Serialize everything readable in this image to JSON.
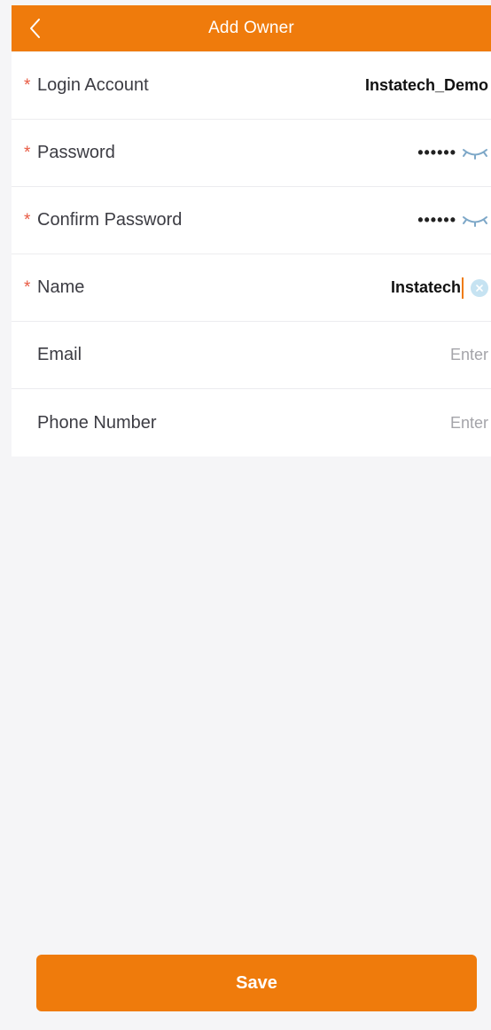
{
  "header": {
    "title": "Add Owner",
    "back_icon": "chevron-left-icon"
  },
  "form": {
    "login_account": {
      "label": "Login Account",
      "required": "*",
      "value": "Instatech_Demo"
    },
    "password": {
      "label": "Password",
      "required": "*",
      "value": "••••••",
      "icon": "eye-closed-icon"
    },
    "confirm_password": {
      "label": "Confirm Password",
      "required": "*",
      "value": "••••••",
      "icon": "eye-closed-icon"
    },
    "name": {
      "label": "Name",
      "required": "*",
      "value": "Instatech",
      "icon": "clear-icon"
    },
    "email": {
      "label": "Email",
      "placeholder": "Enter"
    },
    "phone": {
      "label": "Phone Number",
      "placeholder": "Enter"
    }
  },
  "actions": {
    "save_label": "Save"
  },
  "colors": {
    "accent": "#ef7b0c",
    "required": "#e85a43",
    "background": "#f5f5f7",
    "clear_badge": "#c6e3f2"
  }
}
